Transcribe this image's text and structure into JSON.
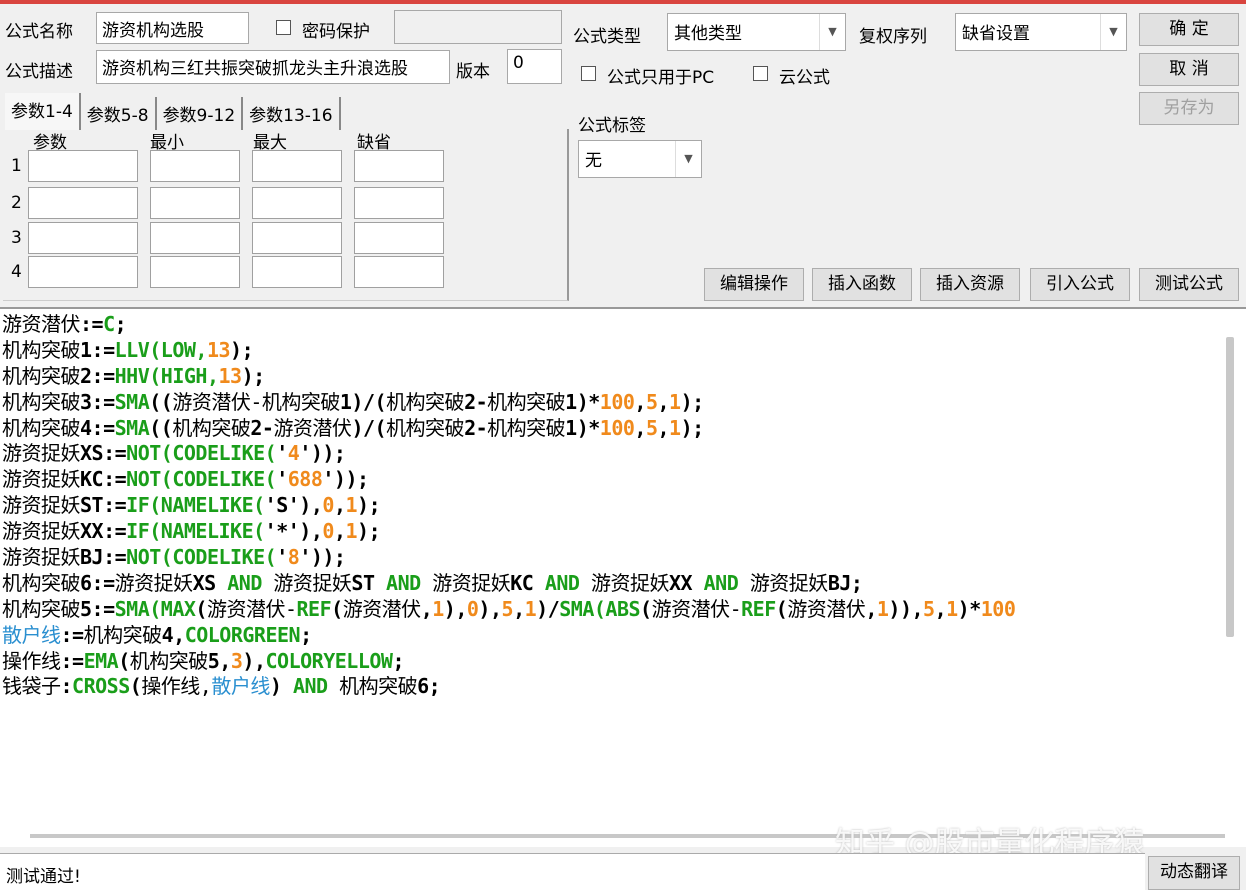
{
  "form": {
    "name_label": "公式名称",
    "name_value": "游资机构选股",
    "password_label": "密码保护",
    "desc_label": "公式描述",
    "desc_value": "游资机构三红共振突破抓龙头主升浪选股",
    "version_label": "版本",
    "version_value": "0",
    "type_label": "公式类型",
    "type_value": "其他类型",
    "rights_label": "复权序列",
    "rights_value": "缺省设置",
    "pc_only_label": "公式只用于PC",
    "cloud_label": "云公式",
    "tag_label": "公式标签",
    "tag_value": "无"
  },
  "buttons": {
    "ok": "确 定",
    "cancel": "取 消",
    "save_as": "另存为",
    "edit": "编辑操作",
    "insert_func": "插入函数",
    "insert_res": "插入资源",
    "import": "引入公式",
    "test": "测试公式",
    "translate": "动态翻译"
  },
  "params": {
    "tabs": [
      "参数1-4",
      "参数5-8",
      "参数9-12",
      "参数13-16"
    ],
    "headers": [
      "参数",
      "最小",
      "最大",
      "缺省"
    ],
    "rows": [
      "1",
      "2",
      "3",
      "4"
    ]
  },
  "code": [
    [
      [
        "t",
        "游资潜伏"
      ],
      [
        "b",
        ":="
      ],
      [
        "f",
        "C"
      ],
      [
        "b",
        ";"
      ]
    ],
    [
      [
        "t",
        "机构突破"
      ],
      [
        "b",
        "1:="
      ],
      [
        "f",
        "LLV(LOW,"
      ],
      [
        "n",
        "13"
      ],
      [
        "b",
        ");"
      ]
    ],
    [
      [
        "t",
        "机构突破"
      ],
      [
        "b",
        "2:="
      ],
      [
        "f",
        "HHV(HIGH,"
      ],
      [
        "n",
        "13"
      ],
      [
        "b",
        ");"
      ]
    ],
    [
      [
        "t",
        "机构突破"
      ],
      [
        "b",
        "3:="
      ],
      [
        "f",
        "SMA"
      ],
      [
        "b",
        "(("
      ],
      [
        "t",
        "游资潜伏-机构突破"
      ],
      [
        "b",
        "1)/("
      ],
      [
        "t",
        "机构突破"
      ],
      [
        "b",
        "2-"
      ],
      [
        "t",
        "机构突破"
      ],
      [
        "b",
        "1)*"
      ],
      [
        "n",
        "100"
      ],
      [
        "b",
        ","
      ],
      [
        "n",
        "5"
      ],
      [
        "b",
        ","
      ],
      [
        "n",
        "1"
      ],
      [
        "b",
        ");"
      ]
    ],
    [
      [
        "t",
        "机构突破"
      ],
      [
        "b",
        "4:="
      ],
      [
        "f",
        "SMA"
      ],
      [
        "b",
        "(("
      ],
      [
        "t",
        "机构突破"
      ],
      [
        "b",
        "2-"
      ],
      [
        "t",
        "游资潜伏"
      ],
      [
        "b",
        ")/("
      ],
      [
        "t",
        "机构突破"
      ],
      [
        "b",
        "2-"
      ],
      [
        "t",
        "机构突破"
      ],
      [
        "b",
        "1)*"
      ],
      [
        "n",
        "100"
      ],
      [
        "b",
        ","
      ],
      [
        "n",
        "5"
      ],
      [
        "b",
        ","
      ],
      [
        "n",
        "1"
      ],
      [
        "b",
        ");"
      ]
    ],
    [
      [
        "t",
        "游资捉妖"
      ],
      [
        "b",
        "XS:="
      ],
      [
        "f",
        "NOT(CODELIKE("
      ],
      [
        "b",
        "'"
      ],
      [
        "n",
        "4"
      ],
      [
        "b",
        "'));"
      ]
    ],
    [
      [
        "t",
        "游资捉妖"
      ],
      [
        "b",
        "KC:="
      ],
      [
        "f",
        "NOT(CODELIKE("
      ],
      [
        "b",
        "'"
      ],
      [
        "n",
        "688"
      ],
      [
        "b",
        "'));"
      ]
    ],
    [
      [
        "t",
        "游资捉妖"
      ],
      [
        "b",
        "ST:="
      ],
      [
        "f",
        "IF(NAMELIKE("
      ],
      [
        "b",
        "'S'),"
      ],
      [
        "n",
        "0"
      ],
      [
        "b",
        ","
      ],
      [
        "n",
        "1"
      ],
      [
        "b",
        ");"
      ]
    ],
    [
      [
        "t",
        "游资捉妖"
      ],
      [
        "b",
        "XX:="
      ],
      [
        "f",
        "IF(NAMELIKE("
      ],
      [
        "b",
        "'*'),"
      ],
      [
        "n",
        "0"
      ],
      [
        "b",
        ","
      ],
      [
        "n",
        "1"
      ],
      [
        "b",
        ");"
      ]
    ],
    [
      [
        "t",
        "游资捉妖"
      ],
      [
        "b",
        "BJ:="
      ],
      [
        "f",
        "NOT(CODELIKE("
      ],
      [
        "b",
        "'"
      ],
      [
        "n",
        "8"
      ],
      [
        "b",
        "'));"
      ]
    ],
    [
      [
        "t",
        "机构突破"
      ],
      [
        "b",
        "6:="
      ],
      [
        "t",
        "游资捉妖"
      ],
      [
        "b",
        "XS "
      ],
      [
        "f",
        "AND "
      ],
      [
        "t",
        "游资捉妖"
      ],
      [
        "b",
        "ST "
      ],
      [
        "f",
        "AND "
      ],
      [
        "t",
        "游资捉妖"
      ],
      [
        "b",
        "KC "
      ],
      [
        "f",
        "AND "
      ],
      [
        "t",
        "游资捉妖"
      ],
      [
        "b",
        "XX "
      ],
      [
        "f",
        "AND "
      ],
      [
        "t",
        "游资捉妖"
      ],
      [
        "b",
        "BJ;"
      ]
    ],
    [
      [
        "t",
        "机构突破"
      ],
      [
        "b",
        "5:="
      ],
      [
        "f",
        "SMA(MAX"
      ],
      [
        "b",
        "("
      ],
      [
        "t",
        "游资潜伏-"
      ],
      [
        "f",
        "REF"
      ],
      [
        "b",
        "("
      ],
      [
        "t",
        "游资潜伏"
      ],
      [
        "b",
        ","
      ],
      [
        "n",
        "1"
      ],
      [
        "b",
        "),"
      ],
      [
        "n",
        "0"
      ],
      [
        "b",
        "),"
      ],
      [
        "n",
        "5"
      ],
      [
        "b",
        ","
      ],
      [
        "n",
        "1"
      ],
      [
        "b",
        ")/"
      ],
      [
        "f",
        "SMA(ABS"
      ],
      [
        "b",
        "("
      ],
      [
        "t",
        "游资潜伏-"
      ],
      [
        "f",
        "REF"
      ],
      [
        "b",
        "("
      ],
      [
        "t",
        "游资潜伏"
      ],
      [
        "b",
        ","
      ],
      [
        "n",
        "1"
      ],
      [
        "b",
        ")),"
      ],
      [
        "n",
        "5"
      ],
      [
        "b",
        ","
      ],
      [
        "n",
        "1"
      ],
      [
        "b",
        ")*"
      ],
      [
        "n",
        "100"
      ]
    ],
    [
      [
        "v",
        "散户线"
      ],
      [
        "b",
        ":="
      ],
      [
        "t",
        "机构突破"
      ],
      [
        "b",
        "4,"
      ],
      [
        "f",
        "COLORGREEN"
      ],
      [
        "b",
        ";"
      ]
    ],
    [
      [
        "t",
        "操作线"
      ],
      [
        "b",
        ":="
      ],
      [
        "f",
        "EMA"
      ],
      [
        "b",
        "("
      ],
      [
        "t",
        "机构突破"
      ],
      [
        "b",
        "5,"
      ],
      [
        "n",
        "3"
      ],
      [
        "b",
        "),"
      ],
      [
        "f",
        "COLORYELLOW"
      ],
      [
        "b",
        ";"
      ]
    ],
    [
      [
        "t",
        "钱袋子"
      ],
      [
        "b",
        ":"
      ],
      [
        "f",
        "CROSS"
      ],
      [
        "b",
        "("
      ],
      [
        "t",
        "操作线,"
      ],
      [
        "v",
        "散户线"
      ],
      [
        "b",
        ") "
      ],
      [
        "f",
        "AND "
      ],
      [
        "t",
        "机构突破"
      ],
      [
        "b",
        "6;"
      ]
    ]
  ],
  "status": "测试通过!",
  "watermark": "知乎 @股市量化程序猿"
}
